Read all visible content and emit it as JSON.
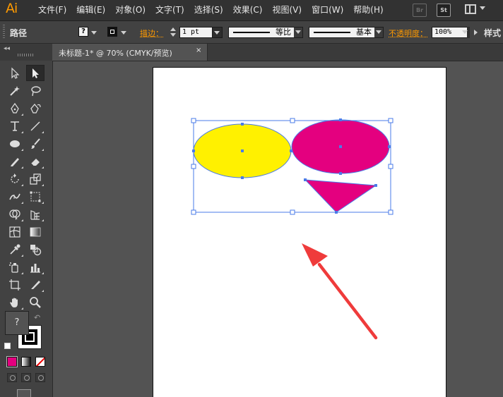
{
  "app": {
    "logo": "Ai"
  },
  "menu": [
    "文件(F)",
    "编辑(E)",
    "对象(O)",
    "文字(T)",
    "选择(S)",
    "效果(C)",
    "视图(V)",
    "窗口(W)",
    "帮助(H)"
  ],
  "header_badges": {
    "bridge": "Br",
    "stock": "St"
  },
  "control_bar": {
    "selection_label": "路径",
    "fill_swatch_glyph": "?",
    "stroke_label": "描边：",
    "stroke_weight": "1 pt",
    "variable_width_label": "等比",
    "brush_label": "基本",
    "opacity_label": "不透明度：",
    "opacity_value": "100%",
    "style_label": "样式"
  },
  "document_tab": {
    "title": "未标题-1* @ 70% (CMYK/预览)",
    "close_glyph": "×"
  },
  "tools_panel": {
    "collapse_glyph": "◂◂",
    "fill_indicator_glyph": "?",
    "swap_glyph": "↶",
    "fill_color": "#535353",
    "stroke_color": "#000000",
    "color_mode_swatch": "#E4007F"
  },
  "artwork": {
    "yellow_ellipse_color": "#FFF100",
    "magenta_ellipse_color": "#E4007F",
    "triangle_color": "#E4007F",
    "selection_color": "#4A7BE8",
    "annotation_arrow_color": "#EF3B3B"
  }
}
